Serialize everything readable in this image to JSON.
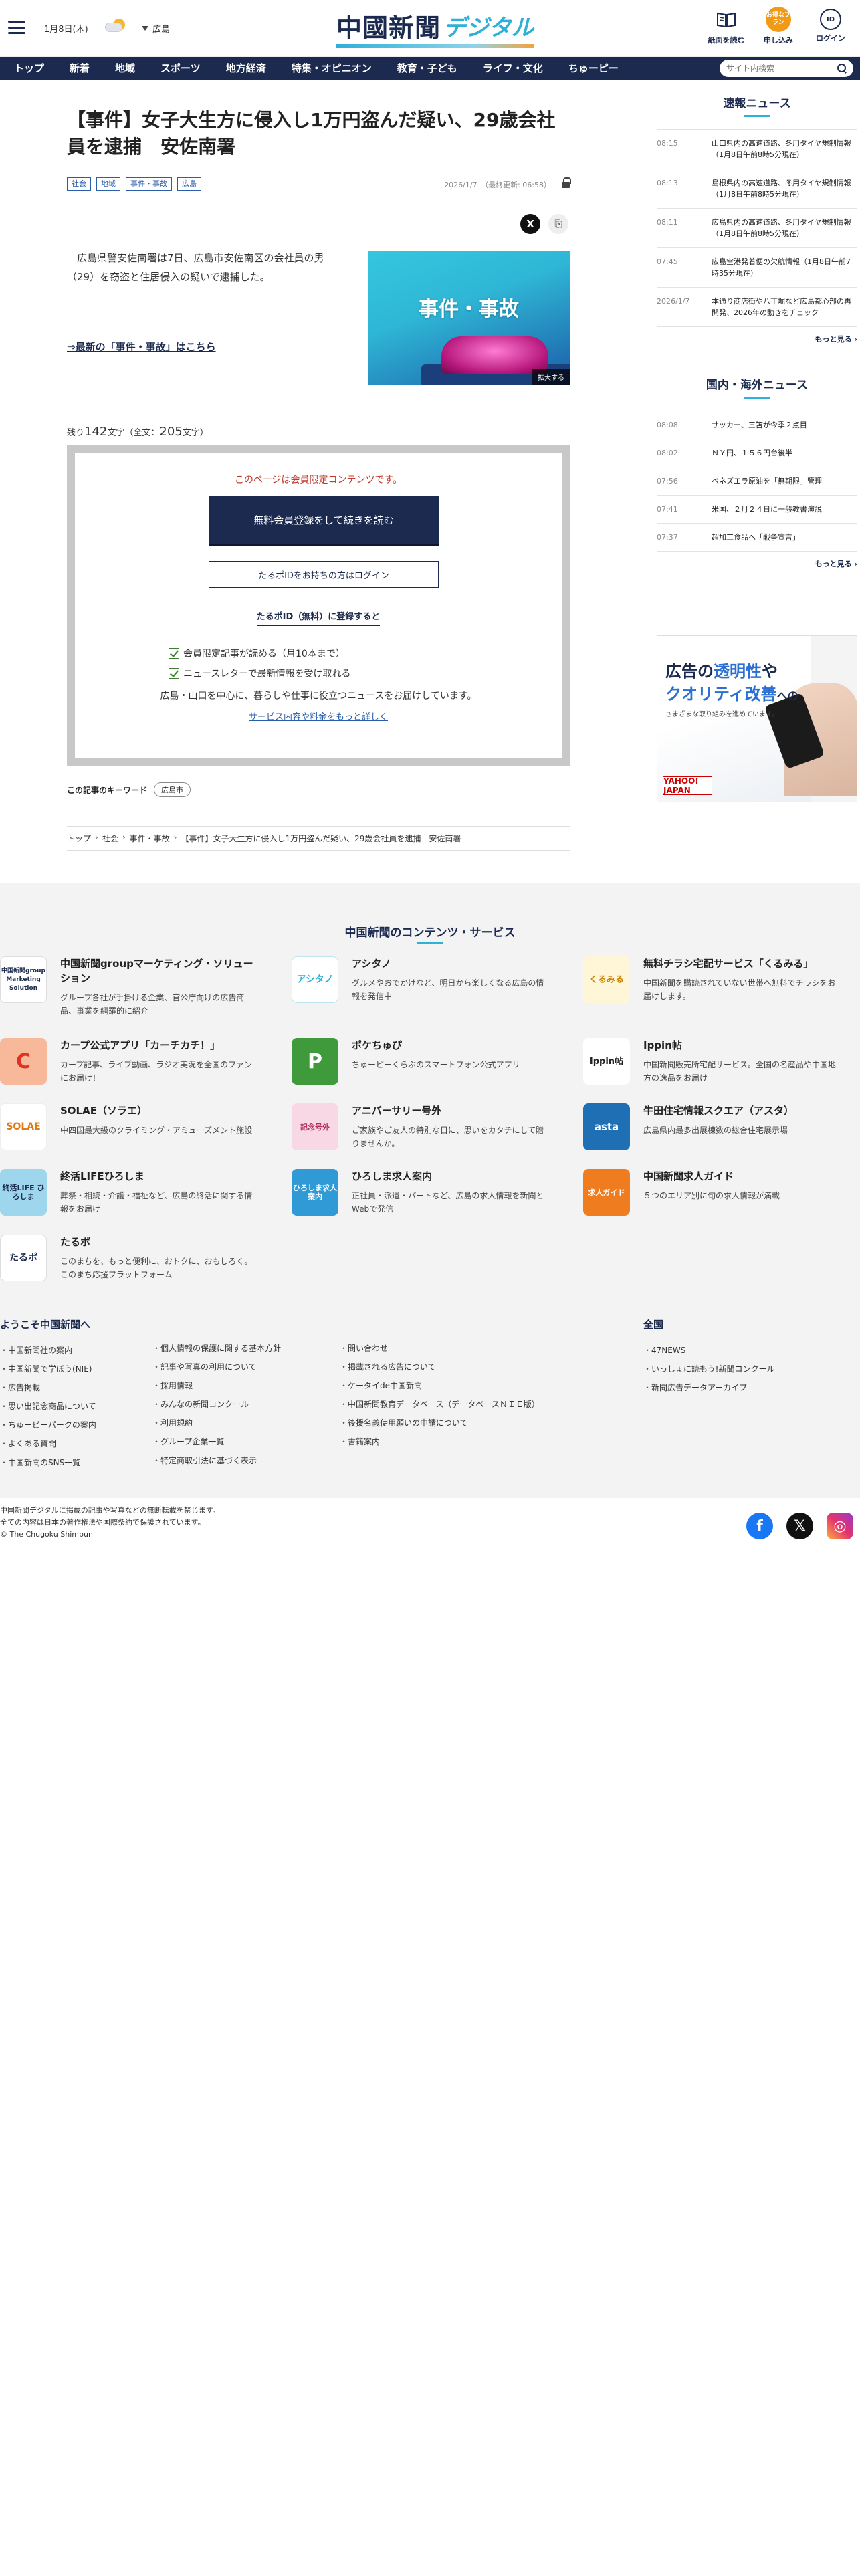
{
  "header": {
    "date": "1月8日(木)",
    "location": "広島",
    "logo_main": "中國新聞",
    "logo_sub": "デジタル",
    "buttons": [
      {
        "label": "紙面を読む",
        "icon": "newspaper-icon"
      },
      {
        "label": "申し込み",
        "icon": "apply-icon",
        "badge": "お得なプラン"
      },
      {
        "label": "ログイン",
        "icon": "login-icon",
        "badge": "ID"
      }
    ]
  },
  "nav": {
    "items": [
      "トップ",
      "新着",
      "地域",
      "スポーツ",
      "地方経済",
      "特集・オピニオン",
      "教育・子ども",
      "ライフ・文化",
      "ちゅーピー"
    ],
    "search_placeholder": "サイト内検索"
  },
  "article": {
    "title": "【事件】女子大生方に侵入し1万円盗んだ疑い、29歳会社員を逮捕　安佐南署",
    "tags": [
      "社会",
      "地域",
      "事件・事故",
      "広島"
    ],
    "date": "2026/1/7　（最終更新: 06:58）",
    "lead": "広島県警安佐南署は7日、広島市安佐南区の会社員の男（29）を窃盗と住居侵入の疑いで逮捕した。",
    "more_link": "⇒最新の「事件・事故」はこちら",
    "photo_text": "事件・事故",
    "enlarge": "拡大する",
    "remaining_prefix": "残り",
    "remaining_count": "142",
    "remaining_mid": "文字（全文：",
    "total_count": "205",
    "remaining_suffix": "文字）"
  },
  "paywall": {
    "notice": "このページは会員限定コンテンツです。",
    "register_button": "無料会員登録をして続きを読む",
    "login_button": "たるポIDをお持ちの方はログイン",
    "free_heading": "たるポID（無料）に登録すると",
    "benefits": [
      "会員限定記事が読める（月10本まで）",
      "ニュースレターで最新情報を受け取れる"
    ],
    "description": "広島・山口を中心に、暮らしや仕事に役立つニュースをお届けしています。",
    "service_link": "サービス内容や料金をもっと詳しく"
  },
  "keywords": {
    "label": "この記事のキーワード",
    "items": [
      "広島市"
    ]
  },
  "breadcrumb": [
    "トップ",
    "社会",
    "事件・事故",
    "【事件】女子大生方に侵入し1万円盗んだ疑い、29歳会社員を逮捕　安佐南署"
  ],
  "sidebar": {
    "breaking": {
      "heading": "速報ニュース",
      "items": [
        {
          "time": "08:15",
          "title": "山口県内の高速道路、冬用タイヤ規制情報（1月8日午前8時5分現在）"
        },
        {
          "time": "08:13",
          "title": "島根県内の高速道路、冬用タイヤ規制情報（1月8日午前8時5分現在）"
        },
        {
          "time": "08:11",
          "title": "広島県内の高速道路、冬用タイヤ規制情報（1月8日午前8時5分現在）"
        },
        {
          "time": "07:45",
          "title": "広島空港発着便の欠航情報（1月8日午前7時35分現在）"
        },
        {
          "time": "2026/1/7",
          "title": "本通り商店街や八丁堀など広島都心部の再開発、2026年の動きをチェック"
        }
      ],
      "more": "もっと見る"
    },
    "world": {
      "heading": "国内・海外ニュース",
      "items": [
        {
          "time": "08:08",
          "title": "サッカー、三笘が今季２点目"
        },
        {
          "time": "08:02",
          "title": "ＮＹ円、１５６円台後半"
        },
        {
          "time": "07:56",
          "title": "ベネズエラ原油を「無期限」管理"
        },
        {
          "time": "07:41",
          "title": "米国、２月２４日に一般教書演説"
        },
        {
          "time": "07:37",
          "title": "超加工食品へ「戦争宣言」"
        }
      ],
      "more": "もっと見る"
    },
    "ad": {
      "line1a": "広告の",
      "line1b": "透明性",
      "line1c": "や",
      "line2a": "クオリティ改善",
      "line2b": "への",
      "line3": "さまざまな取り組みを進めています。",
      "brand": "YAHOO! JAPAN"
    }
  },
  "services": {
    "heading": "中国新聞のコンテンツ・サービス",
    "items": [
      {
        "name": "中国新聞groupマーケティング・ソリューション",
        "desc": "グループ各社が手掛ける企業、官公庁向けの広告商品、事業を網羅的に紹介",
        "icon": "marketing-solution-icon",
        "icon_text": "中国新聞group Marketing Solution"
      },
      {
        "name": "アシタノ",
        "desc": "グルメやおでかけなど、明日から楽しくなる広島の情報を発信中",
        "icon": "ashitano-icon",
        "icon_text": "アシタノ"
      },
      {
        "name": "無料チラシ宅配サービス「くるみる」",
        "desc": "中国新聞を購読されていない世帯へ無料でチラシをお届けします。",
        "icon": "kurumiru-icon",
        "icon_text": "くるみる"
      },
      {
        "name": "カープ公式アプリ「カーチカチ！」",
        "desc": "カープ記事、ライブ動画、ラジオ実況を全国のファンにお届け！",
        "icon": "carp-app-icon",
        "icon_text": "C"
      },
      {
        "name": "ポケちゅぴ",
        "desc": "ちゅーピーくらぶのスマートフォン公式アプリ",
        "icon": "pokechupi-icon",
        "icon_text": "P"
      },
      {
        "name": "Ippin帖",
        "desc": "中国新聞販売所宅配サービス。全国の名産品や中国地方の逸品をお届け",
        "icon": "ippincho-icon",
        "icon_text": "Ippin帖"
      },
      {
        "name": "SOLAE（ソラエ）",
        "desc": "中四国最大級のクライミング・アミューズメント施設",
        "icon": "solae-icon",
        "icon_text": "SOLAE"
      },
      {
        "name": "アニバーサリー号外",
        "desc": "ご家族やご友人の特別な日に、思いをカタチにして贈りませんか。",
        "icon": "anniversary-icon",
        "icon_text": "記念号外"
      },
      {
        "name": "牛田住宅情報スクエア（アスタ）",
        "desc": "広島県内最多出展棟数の総合住宅展示場",
        "icon": "asta-icon",
        "icon_text": "asta"
      },
      {
        "name": "終活LIFEひろしま",
        "desc": "葬祭・相続・介護・福祉など、広島の終活に関する情報をお届け",
        "icon": "shukatsu-icon",
        "icon_text": "終活LIFE ひろしま"
      },
      {
        "name": "ひろしま求人案内",
        "desc": "正社員・派遣・パートなど、広島の求人情報を新聞とWebで発信",
        "icon": "hiroshima-job-icon",
        "icon_text": "ひろしま求人案内"
      },
      {
        "name": "中国新聞求人ガイド",
        "desc": "５つのエリア別に旬の求人情報が満載",
        "icon": "job-guide-icon",
        "icon_text": "求人ガイド"
      },
      {
        "name": "たるポ",
        "desc": "このまちを、もっと便利に、おトクに、おもしろく。このまち応援プラットフォーム",
        "icon": "tarupo-icon",
        "icon_text": "たるポ"
      }
    ]
  },
  "footer": {
    "col1_heading": "ようこそ中国新聞へ",
    "col1": [
      "中国新聞社の案内",
      "中国新聞で学ぼう(NIE)",
      "広告掲載",
      "思い出記念商品について",
      "ちゅーピーパークの案内",
      "よくある質問",
      "中国新聞のSNS一覧"
    ],
    "col2": [
      "個人情報の保護に関する基本方針",
      "記事や写真の利用について",
      "採用情報",
      "みんなの新聞コンクール",
      "利用規約",
      "グループ企業一覧",
      "特定商取引法に基づく表示"
    ],
    "col3": [
      "問い合わせ",
      "掲載される広告について",
      "ケータイde中国新聞",
      "中国新聞教育データベース（データベースＮＩＥ版）",
      "後援名義使用願いの申請について",
      "書籍案内"
    ],
    "col4_heading": "全国",
    "col4": [
      "47NEWS",
      "いっしょに読もう!新聞コンクール",
      "新聞広告データアーカイブ"
    ],
    "copy1": "中国新聞デジタルに掲載の記事や写真などの無断転載を禁じます。",
    "copy2": "全ての内容は日本の著作権法や国際条約で保護されています。",
    "copy3": "© The Chugoku Shimbun",
    "social": [
      {
        "name": "facebook",
        "glyph": "f",
        "color": "#1877f2"
      },
      {
        "name": "x",
        "glyph": "𝕏",
        "color": "#111111"
      },
      {
        "name": "instagram",
        "glyph": "◎",
        "color": "#d6249f"
      }
    ]
  }
}
